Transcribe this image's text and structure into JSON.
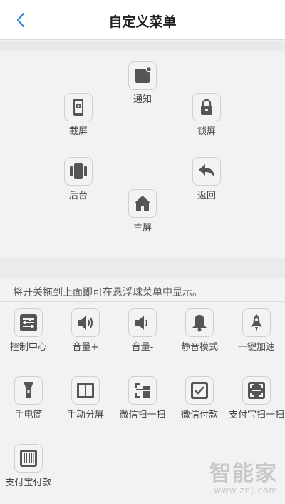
{
  "header": {
    "title": "自定义菜单",
    "back_icon": "chevron-left-icon"
  },
  "menu": {
    "items": [
      {
        "label": "通知",
        "icon": "notification-icon"
      },
      {
        "label": "截屏",
        "icon": "screenshot-icon"
      },
      {
        "label": "锁屏",
        "icon": "lock-icon"
      },
      {
        "label": "后台",
        "icon": "recent-apps-icon"
      },
      {
        "label": "返回",
        "icon": "back-arrow-icon"
      },
      {
        "label": "主屏",
        "icon": "home-icon"
      }
    ]
  },
  "hint": "将开关拖到上面即可在悬浮球菜单中显示。",
  "switches": [
    {
      "label": "控制中心",
      "icon": "control-center-icon"
    },
    {
      "label": "音量+",
      "icon": "volume-up-icon"
    },
    {
      "label": "音量-",
      "icon": "volume-down-icon"
    },
    {
      "label": "静音模式",
      "icon": "bell-icon"
    },
    {
      "label": "一键加速",
      "icon": "rocket-icon"
    },
    {
      "label": "手电筒",
      "icon": "flashlight-icon"
    },
    {
      "label": "手动分屏",
      "icon": "split-screen-icon"
    },
    {
      "label": "微信扫一扫",
      "icon": "wechat-scan-icon"
    },
    {
      "label": "微信付款",
      "icon": "wechat-pay-icon"
    },
    {
      "label": "支付宝扫一扫",
      "icon": "alipay-scan-icon"
    },
    {
      "label": "支付宝付款",
      "icon": "alipay-pay-icon"
    }
  ],
  "watermark": {
    "logo_text": "智能家",
    "url": "www.znj.com"
  },
  "colors": {
    "icon_fill": "#555555",
    "icon_border": "#cfcfcf",
    "background": "#f2f2f2"
  }
}
